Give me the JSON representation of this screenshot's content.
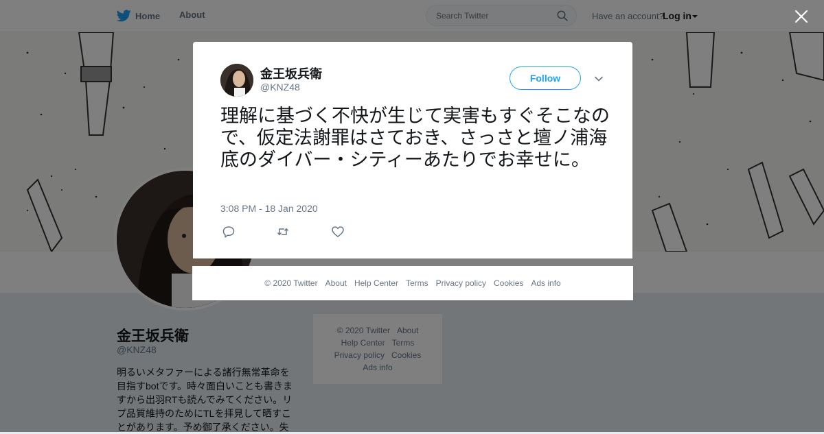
{
  "nav": {
    "home_label": "Home",
    "about_label": "About",
    "search_placeholder": "Search Twitter",
    "account_prompt": "Have an account?",
    "login_label": "Log in"
  },
  "profile": {
    "name": "金王坂兵衛",
    "handle": "@KNZ48",
    "bio": "明るいメタファーによる諸行無常革命を目指すbotです。時々面白いことも書きますから出羽RTも読んでみてください。リプ品質維持のためにTLを拝見して晒すことがあります。予め御了承ください。失"
  },
  "side_footer": {
    "items": [
      "© 2020 Twitter",
      "About",
      "Help Center",
      "Terms",
      "Privacy policy",
      "Cookies",
      "Ads info"
    ]
  },
  "tweet": {
    "name": "金王坂兵衛",
    "handle": "@KNZ48",
    "follow_label": "Follow",
    "text": "理解に基づく不快が生じて実害もすぐそこなので、仮定法謝罪はさておき、さっさと壇ノ浦海底のダイバー・シティーあたりでお幸せに。",
    "timestamp": "3:08 PM - 18 Jan 2020"
  },
  "footer": {
    "items": [
      "© 2020 Twitter",
      "About",
      "Help Center",
      "Terms",
      "Privacy policy",
      "Cookies",
      "Ads info"
    ]
  },
  "colors": {
    "accent": "#1da1f2",
    "overlay": "rgba(0,0,0,0.5)",
    "secondary_text": "#657786"
  },
  "icons": {
    "logo": "twitter-bird-icon",
    "close": "close-icon",
    "search": "search-icon",
    "reply": "reply-icon",
    "retweet": "retweet-icon",
    "like": "heart-icon",
    "caret": "chevron-down-icon"
  }
}
